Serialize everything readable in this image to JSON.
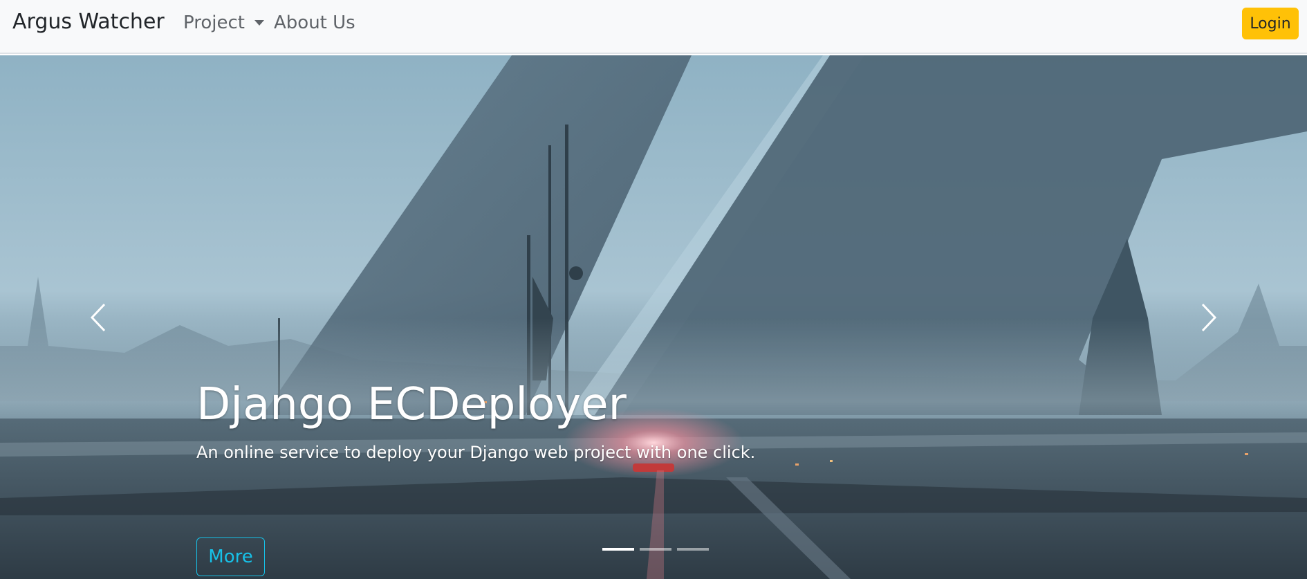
{
  "navbar": {
    "brand": "Argus Watcher",
    "project_label": "Project",
    "about_label": "About Us",
    "login_label": "Login"
  },
  "carousel": {
    "slide": {
      "title": "Django ECDeployer",
      "subtitle": "An online service to deploy your Django web project with one click.",
      "button_label": "More",
      "background": "foggy futuristic city with huge slanted concrete towers and a glowing vehicle on a wet road"
    },
    "indicators": {
      "count": 3,
      "active_index": 0
    }
  },
  "colors": {
    "navbar_bg": "#f8f9fa",
    "login_button": "#ffc107",
    "more_button": "#17c1e8"
  },
  "icons": {
    "prev": "chevron-left-icon",
    "next": "chevron-right-icon",
    "dropdown": "caret-down-icon"
  }
}
